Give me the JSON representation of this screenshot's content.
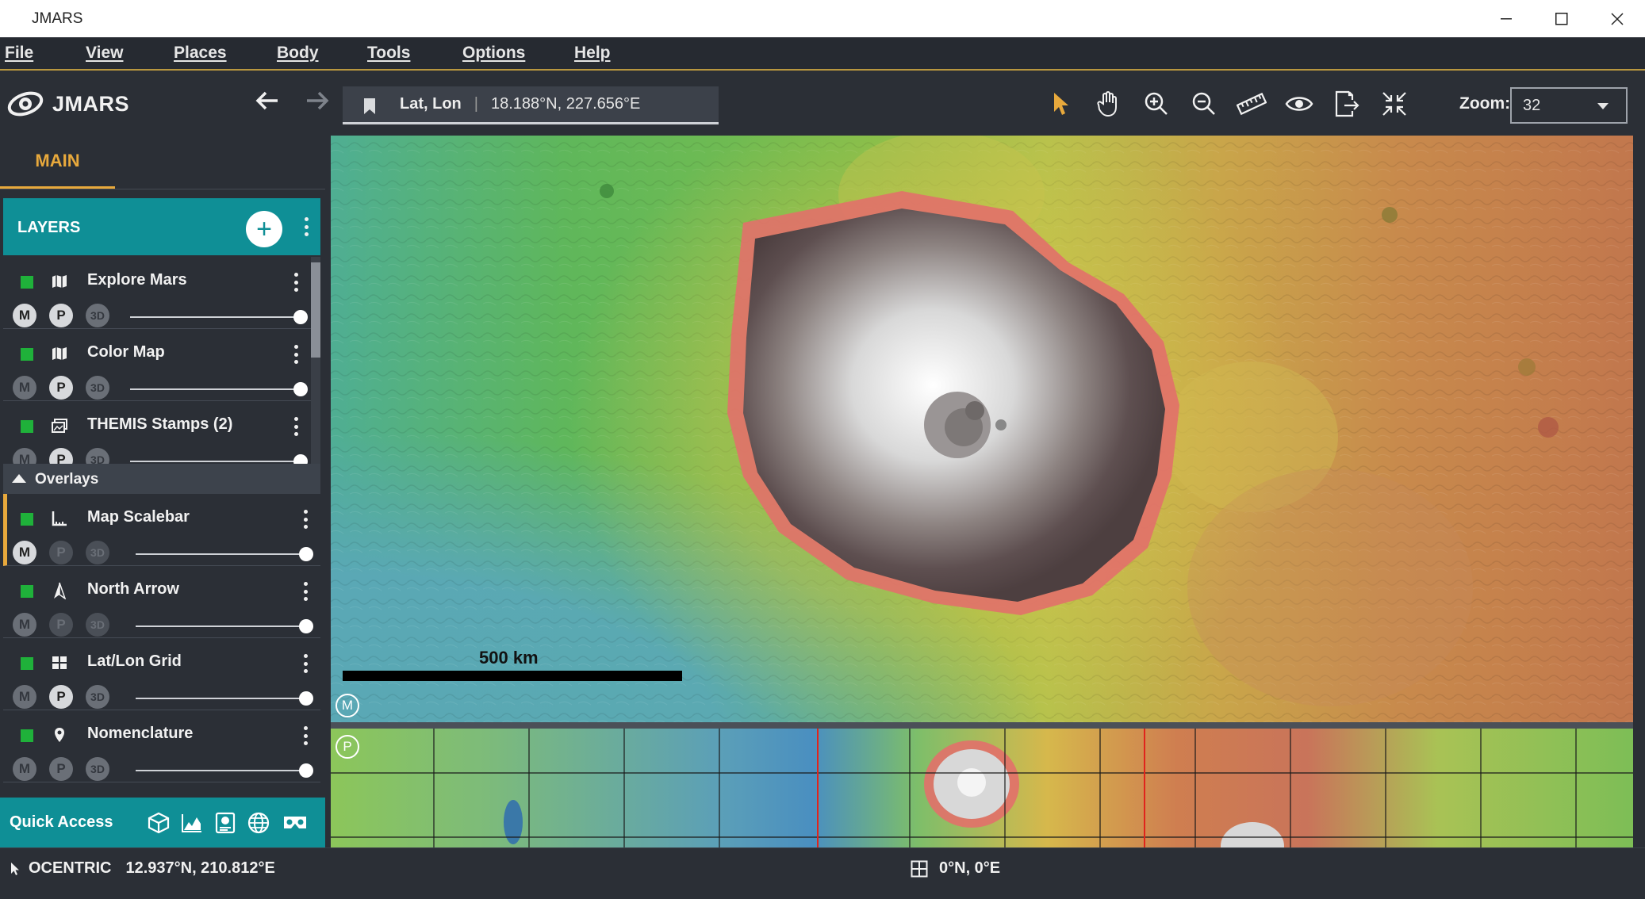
{
  "window": {
    "title": "JMARS"
  },
  "menu": [
    "File",
    "View",
    "Places",
    "Body",
    "Tools",
    "Options",
    "Help"
  ],
  "toolbar": {
    "app_name": "JMARS",
    "location_label": "Lat, Lon",
    "location_value": "18.188°N, 227.656°E",
    "zoom_label": "Zoom:",
    "zoom_value": "32",
    "accent": "#e8a93c"
  },
  "panel": {
    "tab": "MAIN",
    "layers_title": "LAYERS",
    "layers": [
      {
        "name": "Explore Mars",
        "icon": "map-icon",
        "visible": true
      },
      {
        "name": "Color Map",
        "icon": "map-icon",
        "visible": true
      },
      {
        "name": "THEMIS Stamps (2)",
        "icon": "stamps-icon",
        "visible": true
      }
    ],
    "overlays_title": "Overlays",
    "overlays": [
      {
        "name": "Map Scalebar",
        "icon": "scalebar-icon",
        "visible": true
      },
      {
        "name": "North Arrow",
        "icon": "north-arrow-icon",
        "visible": true
      },
      {
        "name": "Lat/Lon Grid",
        "icon": "grid-icon",
        "visible": true
      },
      {
        "name": "Nomenclature",
        "icon": "pin-icon",
        "visible": true
      }
    ],
    "mode_labels": {
      "m": "M",
      "p": "P",
      "three_d": "3D"
    },
    "quick_access": "Quick Access",
    "teal": "#0f8f96"
  },
  "map": {
    "scalebar_label": "500 km",
    "main_badge": "M",
    "panner_badge": "P"
  },
  "status": {
    "projection": "OCENTRIC",
    "cursor_coords": "12.937°N, 210.812°E",
    "center_coords": "0°N, 0°E"
  }
}
